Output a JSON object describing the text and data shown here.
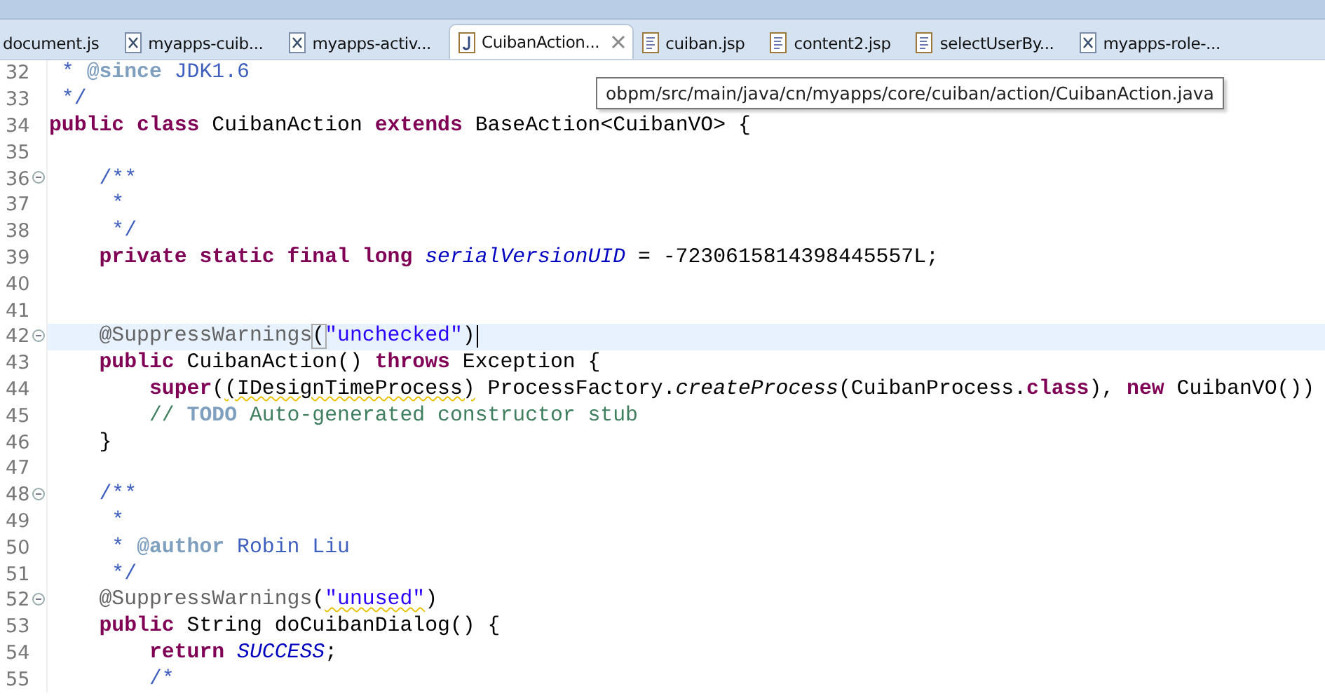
{
  "tabs": [
    {
      "label": "document.js",
      "kind": "none",
      "selected": false
    },
    {
      "label": "myapps-cuib...",
      "kind": "xml",
      "selected": false
    },
    {
      "label": "myapps-activ...",
      "kind": "xml",
      "selected": false
    },
    {
      "label": "CuibanAction...",
      "kind": "java",
      "selected": true
    },
    {
      "label": "cuiban.jsp",
      "kind": "jsp",
      "selected": false
    },
    {
      "label": "content2.jsp",
      "kind": "jsp",
      "selected": false
    },
    {
      "label": "selectUserBy...",
      "kind": "jsp",
      "selected": false
    },
    {
      "label": "myapps-role-...",
      "kind": "xml",
      "selected": false
    }
  ],
  "tooltip": "obpm/src/main/java/cn/myapps/core/cuiban/action/CuibanAction.java",
  "lines": [
    {
      "number": "32",
      "folded": false,
      "current": false,
      "tokens": [
        {
          "kind": "doc",
          "text": " * "
        },
        {
          "kind": "doctag",
          "text": "@since"
        },
        {
          "kind": "doc",
          "text": " JDK1.6"
        }
      ]
    },
    {
      "number": "33",
      "folded": false,
      "current": false,
      "tokens": [
        {
          "kind": "doc",
          "text": " */"
        }
      ]
    },
    {
      "number": "34",
      "folded": false,
      "current": false,
      "tokens": [
        {
          "kind": "kw",
          "text": "public class"
        },
        {
          "kind": "plain",
          "text": " CuibanAction "
        },
        {
          "kind": "kw",
          "text": "extends"
        },
        {
          "kind": "plain",
          "text": " BaseAction<CuibanVO> {"
        }
      ]
    },
    {
      "number": "35",
      "folded": false,
      "current": false
    },
    {
      "number": "36",
      "folded": true,
      "current": false,
      "tokens": [
        {
          "kind": "doc",
          "text": "    /**"
        }
      ]
    },
    {
      "number": "37",
      "folded": false,
      "current": false,
      "tokens": [
        {
          "kind": "doc",
          "text": "     *"
        }
      ]
    },
    {
      "number": "38",
      "folded": false,
      "current": false,
      "tokens": [
        {
          "kind": "doc",
          "text": "     */"
        }
      ]
    },
    {
      "number": "39",
      "folded": false,
      "current": false,
      "tokens": [
        {
          "kind": "kw",
          "text": "    private static final long"
        },
        {
          "kind": "field",
          "text": " serialVersionUID"
        },
        {
          "kind": "plain",
          "text": " = -7230615814398445557L;"
        }
      ]
    },
    {
      "number": "40",
      "folded": false,
      "current": false
    },
    {
      "number": "41",
      "folded": false,
      "current": false
    },
    {
      "number": "42",
      "folded": true,
      "current": true,
      "tokens": [
        {
          "kind": "ann",
          "text": "    @SuppressWarnings"
        },
        {
          "kind": "bracket",
          "text": "("
        },
        {
          "kind": "str",
          "text": "\"unchecked\""
        },
        {
          "kind": "plain",
          "text": ")"
        },
        {
          "kind": "caret"
        }
      ]
    },
    {
      "number": "43",
      "folded": false,
      "current": false,
      "tokens": [
        {
          "kind": "kw",
          "text": "    public"
        },
        {
          "kind": "plain",
          "text": " CuibanAction() "
        },
        {
          "kind": "kw",
          "text": "throws"
        },
        {
          "kind": "plain",
          "text": " Exception {"
        }
      ]
    },
    {
      "number": "44",
      "folded": false,
      "current": false,
      "tokens": [
        {
          "kind": "kw",
          "text": "        super"
        },
        {
          "kind": "plain",
          "text": "("
        },
        {
          "kind": "warn",
          "text": "(IDesignTimeProcess)"
        },
        {
          "kind": "plain",
          "text": " ProcessFactory."
        },
        {
          "kind": "method",
          "text": "createProcess"
        },
        {
          "kind": "plain",
          "text": "(CuibanProcess."
        },
        {
          "kind": "kw",
          "text": "class"
        },
        {
          "kind": "plain",
          "text": "), "
        },
        {
          "kind": "kw",
          "text": "new"
        },
        {
          "kind": "plain",
          "text": " CuibanVO())"
        }
      ]
    },
    {
      "number": "45",
      "folded": false,
      "current": false,
      "tokens": [
        {
          "kind": "cmt",
          "text": "        // "
        },
        {
          "kind": "todo",
          "text": "TODO"
        },
        {
          "kind": "cmt",
          "text": " Auto-generated constructor stub"
        }
      ]
    },
    {
      "number": "46",
      "folded": false,
      "current": false,
      "tokens": [
        {
          "kind": "plain",
          "text": "    }"
        }
      ]
    },
    {
      "number": "47",
      "folded": false,
      "current": false
    },
    {
      "number": "48",
      "folded": true,
      "current": false,
      "tokens": [
        {
          "kind": "doc",
          "text": "    /**"
        }
      ]
    },
    {
      "number": "49",
      "folded": false,
      "current": false,
      "tokens": [
        {
          "kind": "doc",
          "text": "     *"
        }
      ]
    },
    {
      "number": "50",
      "folded": false,
      "current": false,
      "tokens": [
        {
          "kind": "doc",
          "text": "     * "
        },
        {
          "kind": "doctag",
          "text": "@author"
        },
        {
          "kind": "doc",
          "text": " Robin Liu"
        }
      ]
    },
    {
      "number": "51",
      "folded": false,
      "current": false,
      "tokens": [
        {
          "kind": "doc",
          "text": "     */"
        }
      ]
    },
    {
      "number": "52",
      "folded": true,
      "current": false,
      "tokens": [
        {
          "kind": "ann",
          "text": "    @SuppressWarnings"
        },
        {
          "kind": "plain",
          "text": "("
        },
        {
          "kind": "strwarn",
          "text": "\"unused\""
        },
        {
          "kind": "plain",
          "text": ")"
        }
      ]
    },
    {
      "number": "53",
      "folded": false,
      "current": false,
      "tokens": [
        {
          "kind": "kw",
          "text": "    public"
        },
        {
          "kind": "plain",
          "text": " String doCuibanDialog() {"
        }
      ]
    },
    {
      "number": "54",
      "folded": false,
      "current": false,
      "tokens": [
        {
          "kind": "kw",
          "text": "        return"
        },
        {
          "kind": "const",
          "text": " SUCCESS"
        },
        {
          "kind": "plain",
          "text": ";"
        }
      ]
    },
    {
      "number": "55",
      "folded": false,
      "current": false,
      "tokens": [
        {
          "kind": "doc",
          "text": "        /*"
        }
      ]
    }
  ]
}
